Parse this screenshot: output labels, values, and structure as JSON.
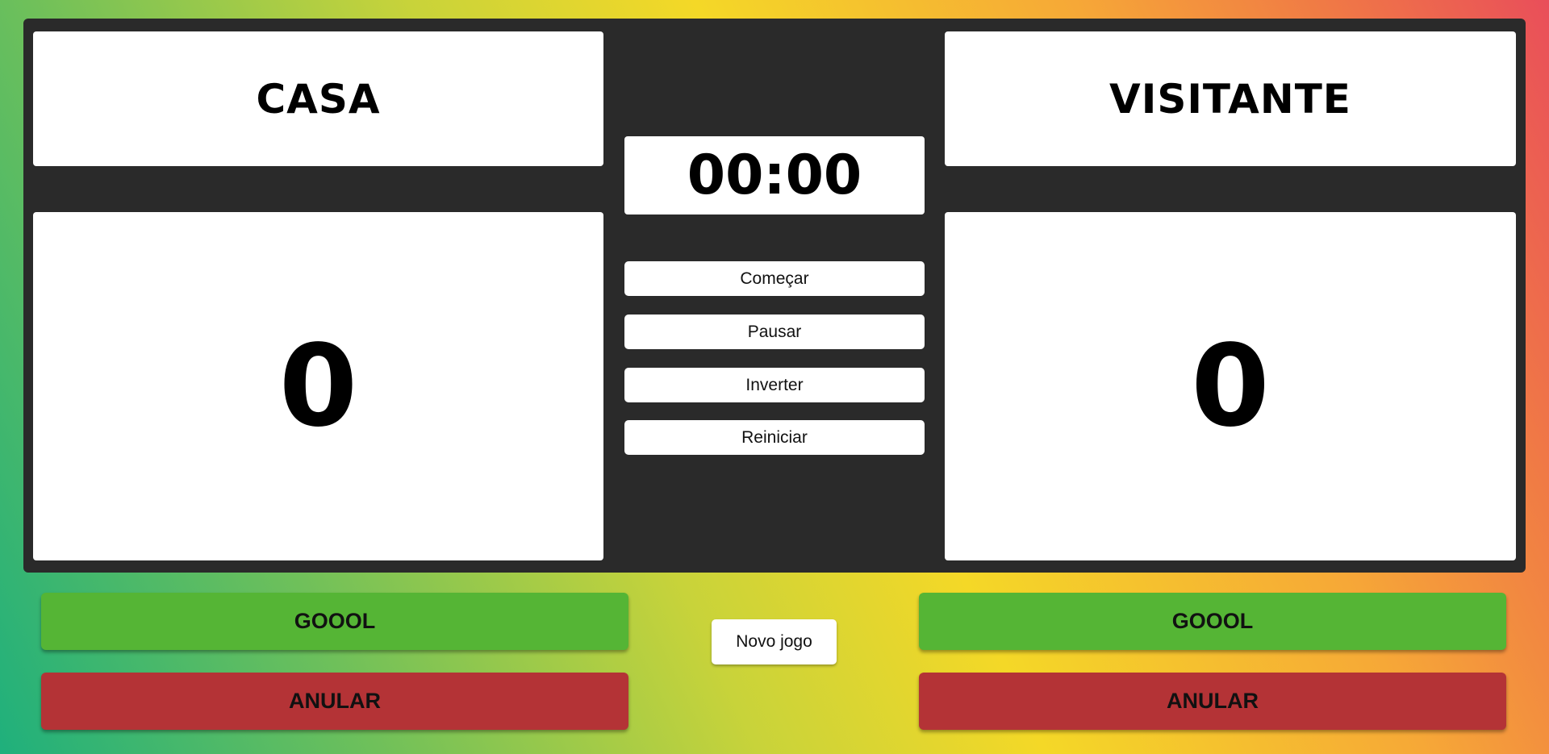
{
  "home": {
    "name": "CASA",
    "score": "0",
    "goal_label": "GOOOL",
    "cancel_label": "ANULAR"
  },
  "away": {
    "name": "VISITANTE",
    "score": "0",
    "goal_label": "GOOOL",
    "cancel_label": "ANULAR"
  },
  "timer": "00:00",
  "controls": {
    "start_label": "Começar",
    "pause_label": "Pausar",
    "swap_label": "Inverter",
    "reset_label": "Reiniciar"
  },
  "new_game_label": "Novo jogo",
  "colors": {
    "board": "#2a2a2a",
    "goal_button": "#55b535",
    "cancel_button": "#b43336"
  }
}
